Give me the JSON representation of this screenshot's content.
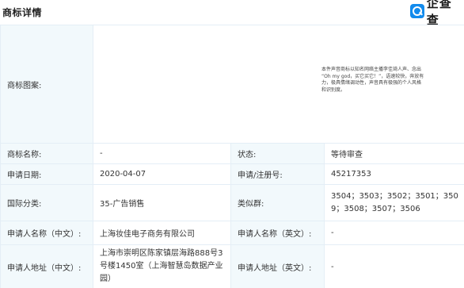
{
  "header": {
    "title": "商标详情",
    "logo_text": "企查查"
  },
  "trademark": {
    "image_label": "商标图案:",
    "image_text": "本件声音商标以知名网络主播李佳琦人声、念出 “Oh my god，买它买它！”，语速较快，奔放有力，极具情绪调动性，声音具有极强的个人风格和识别度。",
    "rows": [
      {
        "l1": "商标名称:",
        "v1": "-",
        "l2": "状态:",
        "v2": "等待审查"
      },
      {
        "l1": "申请日期:",
        "v1": "2020-04-07",
        "l2": "申请/注册号:",
        "v2": "45217353"
      },
      {
        "l1": "国际分类:",
        "v1": "35-广告销售",
        "l2": "类似群:",
        "v2": "3504；3503；3502；3501；3509；3508；3507；3506"
      },
      {
        "l1": "申请人名称（中文）:",
        "v1": "上海妆佳电子商务有限公司",
        "l2": "申请人名称（英文）:",
        "v2": "-"
      },
      {
        "l1": "申请人地址（中文）:",
        "v1": "上海市崇明区陈家镇层海路888号3号楼1450室（上海智慧岛数据产业园）",
        "l2": "申请人地址（英文）:",
        "v2": "-"
      }
    ]
  },
  "colors": {
    "label_bg": "#f2f9fc",
    "border": "#e4eef6",
    "link": "#128bed",
    "logo": "#128bed"
  }
}
